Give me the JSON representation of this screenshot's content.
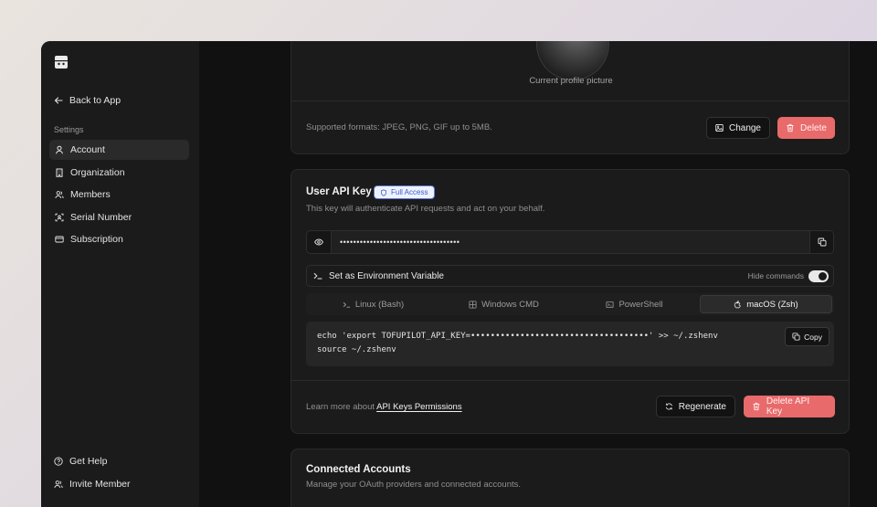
{
  "sidebar": {
    "back_label": "Back to App",
    "section_heading": "Settings",
    "items": [
      {
        "label": "Account",
        "icon": "user-icon",
        "active": true
      },
      {
        "label": "Organization",
        "icon": "building-icon",
        "active": false
      },
      {
        "label": "Members",
        "icon": "users-icon",
        "active": false
      },
      {
        "label": "Serial Number",
        "icon": "scan-icon",
        "active": false
      },
      {
        "label": "Subscription",
        "icon": "credit-card-icon",
        "active": false
      }
    ],
    "footer": {
      "help_label": "Get Help",
      "invite_label": "Invite Member"
    }
  },
  "profile": {
    "caption": "Current profile picture",
    "formats": "Supported formats: JPEG, PNG, GIF up to 5MB.",
    "change_label": "Change",
    "delete_label": "Delete"
  },
  "api_key": {
    "title": "User API Key",
    "badge": "Full Access",
    "description": "This key will authenticate API requests and act on your behalf.",
    "masked_value": "••••••••••••••••••••••••••••••••••••",
    "env_label": "Set as Environment Variable",
    "toggle_label": "Hide commands",
    "toggle_on": true,
    "tabs": [
      {
        "label": "Linux (Bash)",
        "icon": "terminal-icon",
        "active": false
      },
      {
        "label": "Windows CMD",
        "icon": "windows-icon",
        "active": false
      },
      {
        "label": "PowerShell",
        "icon": "powershell-icon",
        "active": false
      },
      {
        "label": "macOS (Zsh)",
        "icon": "apple-icon",
        "active": true
      }
    ],
    "code_line1": "echo 'export TOFUPILOT_API_KEY=••••••••••••••••••••••••••••••••••••' >> ~/.zshenv",
    "code_line2": "source ~/.zshenv",
    "copy_label": "Copy",
    "learn_prefix": "Learn more about",
    "learn_link": "API Keys Permissions",
    "regenerate_label": "Regenerate",
    "delete_label": "Delete API Key"
  },
  "connected": {
    "title": "Connected Accounts",
    "description": "Manage your OAuth providers and connected accounts."
  },
  "colors": {
    "accent_red": "#e96a6a",
    "badge_blue": "#3b5bd1"
  }
}
